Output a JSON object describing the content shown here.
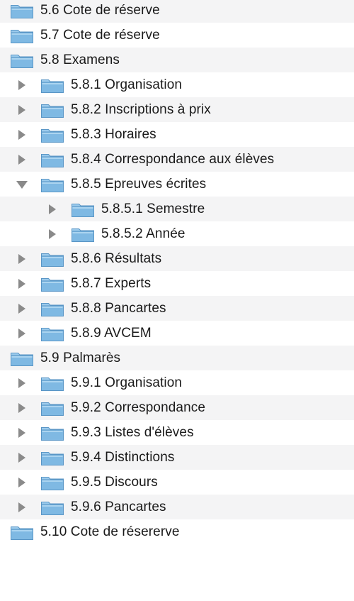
{
  "colors": {
    "stripe": "#f4f4f5",
    "folder_body": "#7fb9e3",
    "folder_tab": "#9ccbec",
    "folder_edge": "#5a96c6",
    "disclosure": "#8a8a8a"
  },
  "icons": {
    "folder": "folder-icon",
    "collapsed": "triangle-right-icon",
    "expanded": "triangle-down-icon"
  },
  "tree": [
    {
      "label": "5.6 Cote de réserve",
      "level": 0,
      "state": "none"
    },
    {
      "label": "5.7 Cote de réserve",
      "level": 0,
      "state": "none"
    },
    {
      "label": "5.8 Examens",
      "level": 0,
      "state": "none"
    },
    {
      "label": "5.8.1 Organisation",
      "level": 1,
      "state": "collapsed"
    },
    {
      "label": "5.8.2 Inscriptions à prix",
      "level": 1,
      "state": "collapsed"
    },
    {
      "label": "5.8.3 Horaires",
      "level": 1,
      "state": "collapsed"
    },
    {
      "label": "5.8.4 Correspondance aux élèves",
      "level": 1,
      "state": "collapsed"
    },
    {
      "label": "5.8.5 Epreuves écrites",
      "level": 1,
      "state": "expanded"
    },
    {
      "label": "5.8.5.1 Semestre",
      "level": 2,
      "state": "collapsed"
    },
    {
      "label": "5.8.5.2 Année",
      "level": 2,
      "state": "collapsed"
    },
    {
      "label": "5.8.6 Résultats",
      "level": 1,
      "state": "collapsed"
    },
    {
      "label": "5.8.7 Experts",
      "level": 1,
      "state": "collapsed"
    },
    {
      "label": "5.8.8 Pancartes",
      "level": 1,
      "state": "collapsed"
    },
    {
      "label": "5.8.9 AVCEM",
      "level": 1,
      "state": "collapsed"
    },
    {
      "label": "5.9 Palmarès",
      "level": 0,
      "state": "none"
    },
    {
      "label": "5.9.1 Organisation",
      "level": 1,
      "state": "collapsed"
    },
    {
      "label": "5.9.2 Correspondance",
      "level": 1,
      "state": "collapsed"
    },
    {
      "label": "5.9.3 Listes d'élèves",
      "level": 1,
      "state": "collapsed"
    },
    {
      "label": "5.9.4 Distinctions",
      "level": 1,
      "state": "collapsed"
    },
    {
      "label": "5.9.5 Discours",
      "level": 1,
      "state": "collapsed"
    },
    {
      "label": "5.9.6 Pancartes",
      "level": 1,
      "state": "collapsed"
    },
    {
      "label": "5.10 Cote de résererve",
      "level": 0,
      "state": "none"
    }
  ]
}
